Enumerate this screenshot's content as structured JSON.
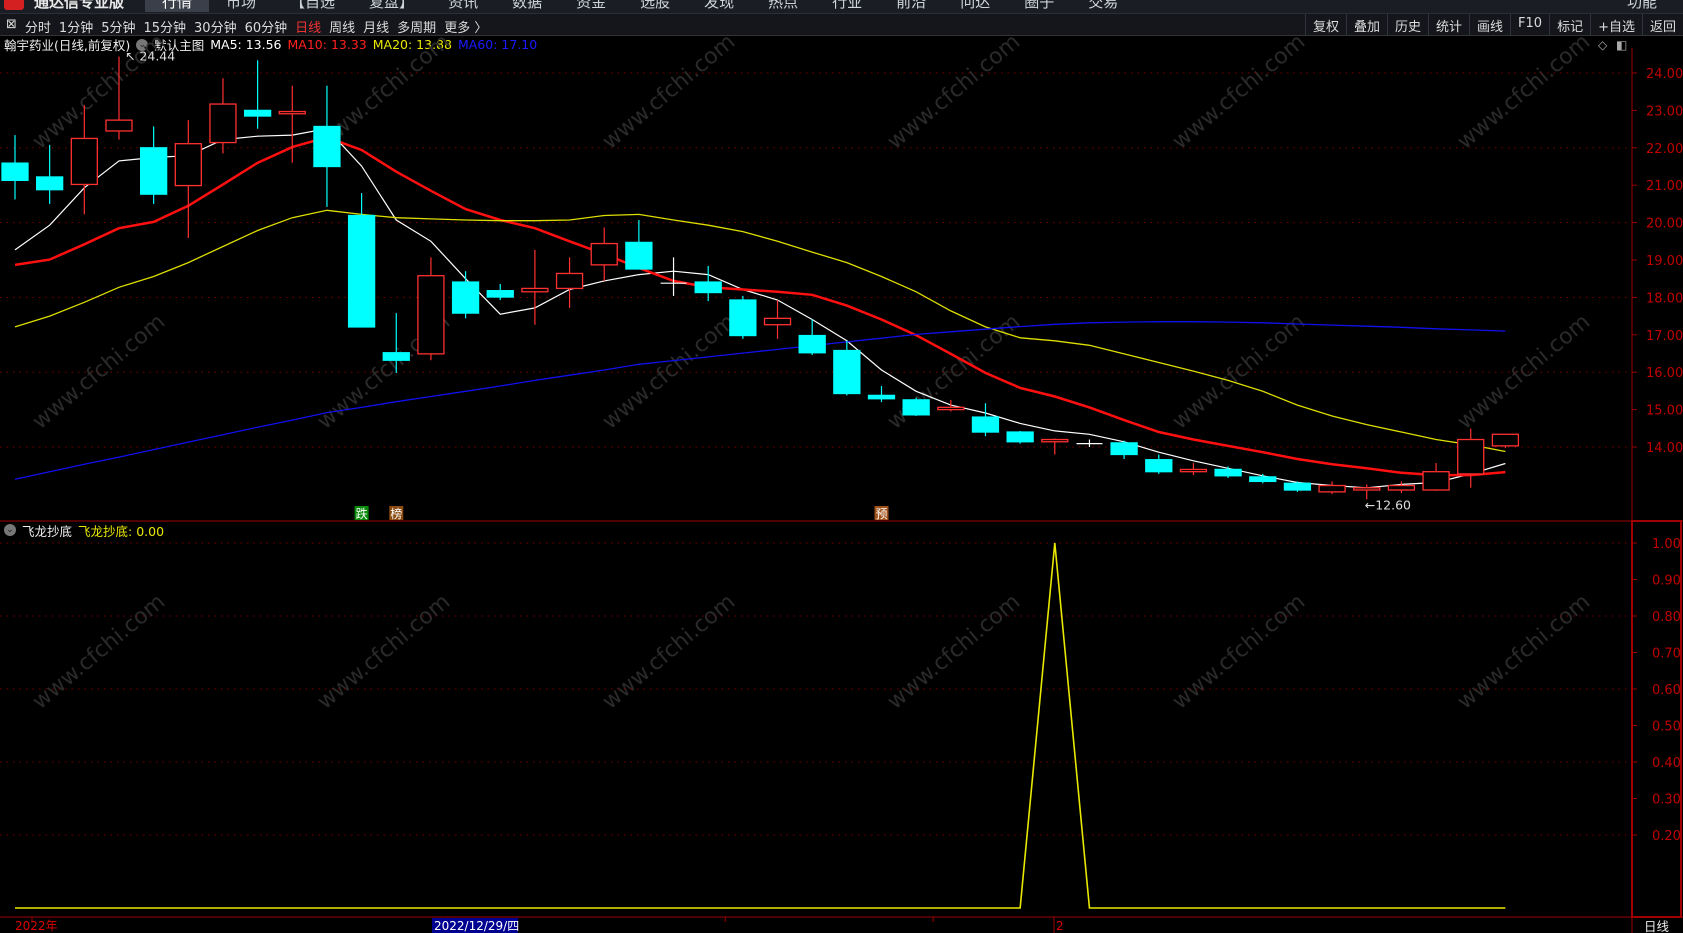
{
  "app": {
    "title": "通达信专业版",
    "menu": [
      "行情",
      "市场",
      "【自选",
      "复盘】",
      "资讯",
      "数据",
      "资金",
      "选股",
      "发现",
      "热点",
      "行业",
      "前沿",
      "问达",
      "圈子",
      "交易"
    ],
    "active_menu": "行情",
    "function_label": "功能"
  },
  "toolbar": {
    "periods": [
      "分时",
      "1分钟",
      "5分钟",
      "15分钟",
      "30分钟",
      "60分钟",
      "日线",
      "周线",
      "月线",
      "多周期",
      "更多 〉"
    ],
    "current_period": "日线",
    "right_buttons": [
      "复权",
      "叠加",
      "历史",
      "统计",
      "画线",
      "F10",
      "标记",
      "+自选",
      "返回"
    ]
  },
  "main_panel": {
    "stock_title": "翰宇药业(日线,前复权)",
    "template": "默认主图",
    "ma_labels": [
      {
        "text": "MA5: 13.56",
        "color": "#ffffff"
      },
      {
        "text": "MA10: 13.33",
        "color": "#ff2020"
      },
      {
        "text": "MA20: 13.88",
        "color": "#e8e800"
      },
      {
        "text": "MA60: 17.10",
        "color": "#1a1aff"
      }
    ],
    "high_label": "24.44",
    "low_label": "←12.60",
    "markers": [
      {
        "index": 10,
        "text": "跌",
        "color": "#0a8a0a"
      },
      {
        "index": 11,
        "text": "榜",
        "color": "#8a4a10"
      },
      {
        "index": 25,
        "text": "预",
        "color": "#a0501a"
      }
    ]
  },
  "indicator_panel": {
    "name": "飞龙抄底",
    "value_label": "飞龙抄底: 0.00"
  },
  "watermark": "www.cfchi.com",
  "bottom_axis": {
    "year_label": "2022年",
    "cursor_date": "2022/12/29/四",
    "month_label": "2",
    "period_label": "日线"
  },
  "colors": {
    "up": "#ff3030",
    "down": "#00ffff",
    "axis": "#a00000",
    "ma5": "#ffffff",
    "ma10": "#ff1010",
    "ma20": "#dddd00",
    "ma60": "#1010ee",
    "indicator": "#e8e800"
  },
  "chart_data": [
    {
      "type": "candlestick",
      "title": "翰宇药业(日线,前复权)",
      "ylim": [
        12.4,
        24.8
      ],
      "yticks": [
        14,
        15,
        16,
        17,
        18,
        19,
        20,
        21,
        22,
        23,
        24
      ],
      "candles": [
        [
          21.59,
          22.34,
          20.62,
          21.13
        ],
        [
          21.22,
          22.08,
          20.5,
          20.88
        ],
        [
          21.02,
          23.14,
          20.22,
          22.25
        ],
        [
          22.45,
          24.44,
          22.22,
          22.74
        ],
        [
          22.0,
          22.57,
          20.5,
          20.76
        ],
        [
          20.99,
          22.74,
          19.59,
          22.11
        ],
        [
          22.14,
          23.86,
          21.85,
          23.17
        ],
        [
          23.0,
          24.34,
          22.51,
          22.85
        ],
        [
          22.91,
          23.66,
          21.6,
          22.97
        ],
        [
          22.57,
          23.66,
          20.42,
          21.5
        ],
        [
          20.19,
          20.79,
          17.21,
          17.21
        ],
        [
          16.52,
          17.58,
          15.98,
          16.32
        ],
        [
          16.49,
          19.07,
          16.32,
          18.58
        ],
        [
          18.41,
          18.7,
          17.44,
          17.58
        ],
        [
          18.18,
          18.36,
          17.93,
          18.01
        ],
        [
          18.15,
          19.27,
          17.27,
          18.24
        ],
        [
          18.24,
          19.07,
          17.72,
          18.64
        ],
        [
          18.87,
          19.87,
          18.44,
          19.44
        ],
        [
          19.47,
          20.07,
          18.76,
          18.76
        ],
        [
          18.38,
          19.07,
          18.04,
          18.38
        ],
        [
          18.41,
          18.84,
          17.9,
          18.13
        ],
        [
          17.93,
          18.04,
          16.89,
          16.98
        ],
        [
          17.27,
          17.93,
          16.89,
          17.44
        ],
        [
          16.98,
          17.41,
          16.46,
          16.52
        ],
        [
          16.58,
          16.84,
          15.38,
          15.43
        ],
        [
          15.38,
          15.63,
          15.2,
          15.29
        ],
        [
          15.26,
          15.32,
          14.83,
          14.86
        ],
        [
          15.0,
          15.26,
          14.95,
          15.06
        ],
        [
          14.8,
          15.17,
          14.29,
          14.4
        ],
        [
          14.4,
          14.43,
          14.09,
          14.14
        ],
        [
          14.14,
          14.23,
          13.8,
          14.2
        ],
        [
          14.09,
          14.2,
          14.0,
          14.09
        ],
        [
          14.11,
          14.17,
          13.68,
          13.8
        ],
        [
          13.66,
          13.8,
          13.28,
          13.34
        ],
        [
          13.34,
          13.57,
          13.25,
          13.4
        ],
        [
          13.4,
          13.48,
          13.17,
          13.23
        ],
        [
          13.2,
          13.28,
          13.03,
          13.08
        ],
        [
          13.03,
          13.08,
          12.8,
          12.85
        ],
        [
          12.8,
          13.08,
          12.74,
          12.97
        ],
        [
          12.85,
          13.0,
          12.6,
          12.91
        ],
        [
          12.85,
          13.08,
          12.77,
          12.97
        ],
        [
          12.85,
          13.57,
          12.83,
          13.34
        ],
        [
          13.28,
          14.49,
          12.91,
          14.2
        ],
        [
          14.03,
          14.34,
          13.97,
          14.34
        ]
      ],
      "series": [
        {
          "name": "MA5",
          "values": [
            19.27,
            19.93,
            20.93,
            21.65,
            21.74,
            21.79,
            22.22,
            22.31,
            22.34,
            22.51,
            21.51,
            20.07,
            19.5,
            18.5,
            17.55,
            17.72,
            18.21,
            18.44,
            18.61,
            18.7,
            18.61,
            18.21,
            17.93,
            17.41,
            16.84,
            16.06,
            15.49,
            15.12,
            14.91,
            14.63,
            14.43,
            14.34,
            14.14,
            13.86,
            13.63,
            13.43,
            13.23,
            13.05,
            12.97,
            12.91,
            13.0,
            13.05,
            13.28,
            13.56
          ]
        },
        {
          "name": "MA10",
          "values": [
            18.87,
            19.01,
            19.42,
            19.85,
            20.02,
            20.45,
            21.02,
            21.6,
            22.02,
            22.28,
            21.94,
            21.36,
            20.85,
            20.36,
            20.07,
            19.85,
            19.5,
            19.16,
            18.79,
            18.44,
            18.27,
            18.21,
            18.15,
            18.07,
            17.78,
            17.41,
            16.99,
            16.49,
            15.98,
            15.58,
            15.35,
            15.06,
            14.72,
            14.4,
            14.2,
            14.03,
            13.86,
            13.68,
            13.54,
            13.43,
            13.31,
            13.25,
            13.25,
            13.33
          ]
        },
        {
          "name": "MA20",
          "values": [
            17.21,
            17.5,
            17.87,
            18.27,
            18.56,
            18.93,
            19.36,
            19.79,
            20.13,
            20.33,
            20.22,
            20.13,
            20.1,
            20.07,
            20.05,
            20.05,
            20.07,
            20.19,
            20.22,
            20.07,
            19.93,
            19.76,
            19.5,
            19.21,
            18.93,
            18.56,
            18.15,
            17.64,
            17.21,
            16.92,
            16.84,
            16.72,
            16.49,
            16.26,
            16.03,
            15.78,
            15.49,
            15.12,
            14.83,
            14.6,
            14.4,
            14.2,
            14.06,
            13.88
          ]
        },
        {
          "name": "MA60",
          "values": [
            13.14,
            13.34,
            13.54,
            13.73,
            13.93,
            14.13,
            14.33,
            14.53,
            14.72,
            14.92,
            15.06,
            15.21,
            15.35,
            15.49,
            15.63,
            15.78,
            15.92,
            16.06,
            16.21,
            16.31,
            16.41,
            16.51,
            16.61,
            16.71,
            16.81,
            16.91,
            17.01,
            17.08,
            17.15,
            17.22,
            17.28,
            17.32,
            17.34,
            17.35,
            17.35,
            17.34,
            17.32,
            17.29,
            17.26,
            17.23,
            17.2,
            17.16,
            17.13,
            17.1
          ]
        }
      ]
    },
    {
      "type": "line",
      "title": "飞龙抄底",
      "ylim": [
        0,
        1.05
      ],
      "yticks": [
        0.2,
        0.3,
        0.4,
        0.5,
        0.6,
        0.7,
        0.8,
        0.9,
        1.0
      ],
      "series": [
        {
          "name": "飞龙抄底",
          "values": [
            0,
            0,
            0,
            0,
            0,
            0,
            0,
            0,
            0,
            0,
            0,
            0,
            0,
            0,
            0,
            0,
            0,
            0,
            0,
            0,
            0,
            0,
            0,
            0,
            0,
            0,
            0,
            0,
            0,
            0,
            1,
            0,
            0,
            0,
            0,
            0,
            0,
            0,
            0,
            0,
            0,
            0,
            0,
            0
          ]
        }
      ]
    }
  ]
}
